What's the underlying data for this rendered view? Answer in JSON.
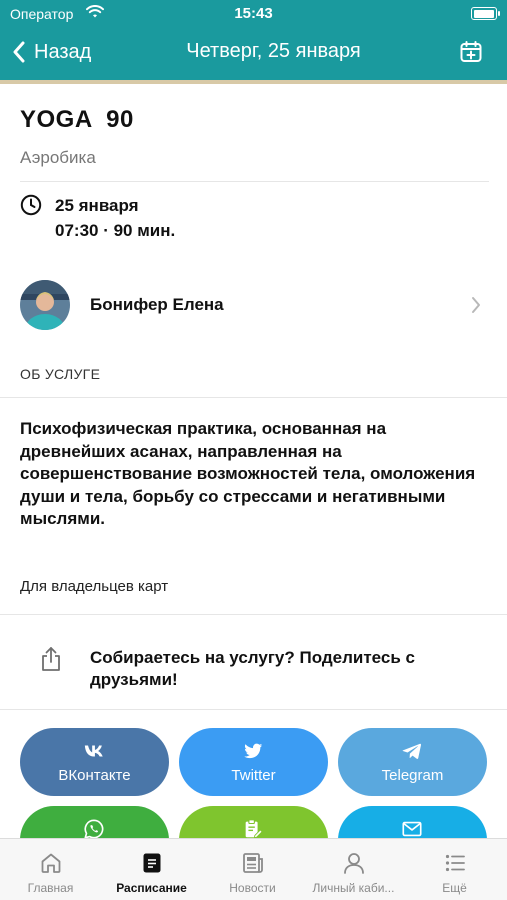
{
  "status_bar": {
    "carrier": "Оператор",
    "time": "15:43"
  },
  "header": {
    "back_label": "Назад",
    "title": "Четверг, 25 января",
    "color": "#1a9a9e"
  },
  "service": {
    "title": "YOGA  90",
    "category": "Аэробика",
    "date": "25 января",
    "time_duration": "07:30 · 90 мин."
  },
  "trainer": {
    "name": "Бонифер Елена"
  },
  "about": {
    "section_label": "ОБ УСЛУГЕ",
    "description": "Психофизическая практика, основанная на древнейших асанах, направленная на совершенствование возможностей тела, омоложения души и тела,  борьбу со стрессами и негативными мыслями.",
    "audience": "Для владельцев карт"
  },
  "share": {
    "prompt": "Собираетесь на услугу? Поделитесь с друзьями!",
    "buttons": [
      {
        "label": "ВКонтакте",
        "icon": "vk-icon",
        "color": "#4a76a8"
      },
      {
        "label": "Twitter",
        "icon": "twitter-icon",
        "color": "#3b9cf3"
      },
      {
        "label": "Telegram",
        "icon": "telegram-icon",
        "color": "#5aa8de"
      },
      {
        "label": "",
        "icon": "whatsapp-icon",
        "color": "#3fae3f"
      },
      {
        "label": "",
        "icon": "notes-icon",
        "color": "#7fc52e"
      },
      {
        "label": "",
        "icon": "mail-icon",
        "color": "#17aee6"
      }
    ]
  },
  "tabbar": {
    "items": [
      {
        "label": "Главная",
        "icon": "home-icon",
        "active": false
      },
      {
        "label": "Расписание",
        "icon": "schedule-icon",
        "active": true
      },
      {
        "label": "Новости",
        "icon": "news-icon",
        "active": false
      },
      {
        "label": "Личный каби...",
        "icon": "person-icon",
        "active": false
      },
      {
        "label": "Ещё",
        "icon": "more-icon",
        "active": false
      }
    ]
  }
}
